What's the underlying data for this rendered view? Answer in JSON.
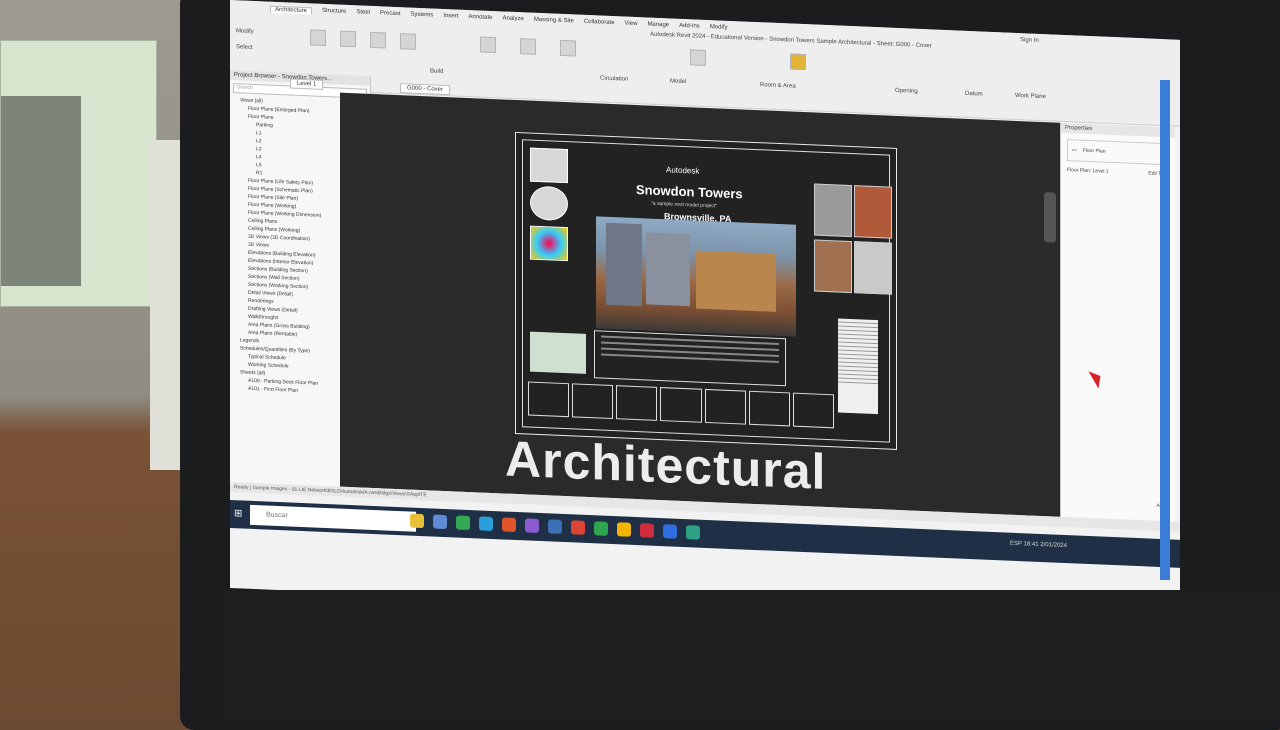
{
  "ribbon": {
    "tabs": [
      "Architecture",
      "Structure",
      "Steel",
      "Precast",
      "Systems",
      "Insert",
      "Annotate",
      "Analyze",
      "Massing & Site",
      "Collaborate",
      "View",
      "Manage",
      "Add-Ins",
      "Modify"
    ],
    "window_title": "Autodesk Revit 2024 - Educational Version - Snowdon Towers Sample Architectural - Sheet: G000 - Cover",
    "groups": [
      "Build",
      "Circulation",
      "Model",
      "Room & Area",
      "Opening",
      "Datum",
      "Work Plane"
    ],
    "select_label": "Select",
    "modify_label": "Modify",
    "sign_in": "Sign In"
  },
  "project_browser": {
    "title": "Project Browser - Snowdon Towers...",
    "search_placeholder": "Search",
    "items": [
      {
        "label": "Views (all)",
        "level": 1
      },
      {
        "label": "Floor Plans (Enlarged Plan)",
        "level": 2
      },
      {
        "label": "Floor Plans",
        "level": 2
      },
      {
        "label": "Parking",
        "level": 3
      },
      {
        "label": "L1",
        "level": 3
      },
      {
        "label": "L2",
        "level": 3
      },
      {
        "label": "L3",
        "level": 3
      },
      {
        "label": "L4",
        "level": 3
      },
      {
        "label": "L5",
        "level": 3
      },
      {
        "label": "R1",
        "level": 3
      },
      {
        "label": "Floor Plans (Life Safety Plan)",
        "level": 2
      },
      {
        "label": "Floor Plans (Schematic Plan)",
        "level": 2
      },
      {
        "label": "Floor Plans (Site Plan)",
        "level": 2
      },
      {
        "label": "Floor Plans (Working)",
        "level": 2
      },
      {
        "label": "Floor Plans (Working Dimension)",
        "level": 2
      },
      {
        "label": "Ceiling Plans",
        "level": 2
      },
      {
        "label": "Ceiling Plans (Working)",
        "level": 2
      },
      {
        "label": "3D Views (3D Coordination)",
        "level": 2
      },
      {
        "label": "3D Views",
        "level": 2
      },
      {
        "label": "Elevations (Building Elevation)",
        "level": 2
      },
      {
        "label": "Elevations (Interior Elevation)",
        "level": 2
      },
      {
        "label": "Sections (Building Section)",
        "level": 2
      },
      {
        "label": "Sections (Wall Section)",
        "level": 2
      },
      {
        "label": "Sections (Working Section)",
        "level": 2
      },
      {
        "label": "Detail Views (Detail)",
        "level": 2
      },
      {
        "label": "Renderings",
        "level": 2
      },
      {
        "label": "Drafting Views (Detail)",
        "level": 2
      },
      {
        "label": "Walkthroughs",
        "level": 2
      },
      {
        "label": "Area Plans (Gross Building)",
        "level": 2
      },
      {
        "label": "Area Plans (Rentable)",
        "level": 2
      },
      {
        "label": "Legends",
        "level": 1
      },
      {
        "label": "Schedules/Quantities (By Type)",
        "level": 1
      },
      {
        "label": "Typical Schedule",
        "level": 2
      },
      {
        "label": "Working Schedule",
        "level": 2
      },
      {
        "label": "Sheets (all)",
        "level": 1
      },
      {
        "label": "A100 - Parking Deck Floor Plan",
        "level": 2
      },
      {
        "label": "A101 - First Floor Plan",
        "level": 2
      }
    ]
  },
  "view_tabs": [
    "Level 1",
    "G000 - Cover"
  ],
  "sheet": {
    "company": "Autodesk",
    "title": "Snowdon Towers",
    "subtitle": "\"a sample revit model project\"",
    "location": "Brownsville, PA"
  },
  "overlay_label": "Architectural",
  "properties": {
    "title": "Properties",
    "type_name": "Floor Plan",
    "instance": "Floor Plan: Level 1",
    "edit_type": "Edit Type",
    "apply": "Apply"
  },
  "status_bar": "Ready | Sample Images - 01-LIE Network\\BSLD\\AutodeskIA.rws\\Bldgs\\Views\\SApptTE",
  "taskbar": {
    "search_placeholder": "Buscar",
    "time": "18:41",
    "date": "2/01/2024",
    "lang": "ESP",
    "apps": [
      {
        "name": "file-explorer",
        "color": "#e8c03a"
      },
      {
        "name": "calculator",
        "color": "#5f8bd4"
      },
      {
        "name": "chrome",
        "color": "#34a853"
      },
      {
        "name": "edge",
        "color": "#2b9fd9"
      },
      {
        "name": "brave",
        "color": "#e0552b"
      },
      {
        "name": "visual-studio",
        "color": "#8a5bd1"
      },
      {
        "name": "revit",
        "color": "#3b6fb6"
      },
      {
        "name": "chrome-2",
        "color": "#db4437"
      },
      {
        "name": "recorder",
        "color": "#2ea44f"
      },
      {
        "name": "chrome-3",
        "color": "#f4b400"
      },
      {
        "name": "acrobat",
        "color": "#d22b3c"
      },
      {
        "name": "app-blue",
        "color": "#2f6de0"
      },
      {
        "name": "app-green",
        "color": "#2fa084"
      }
    ]
  }
}
